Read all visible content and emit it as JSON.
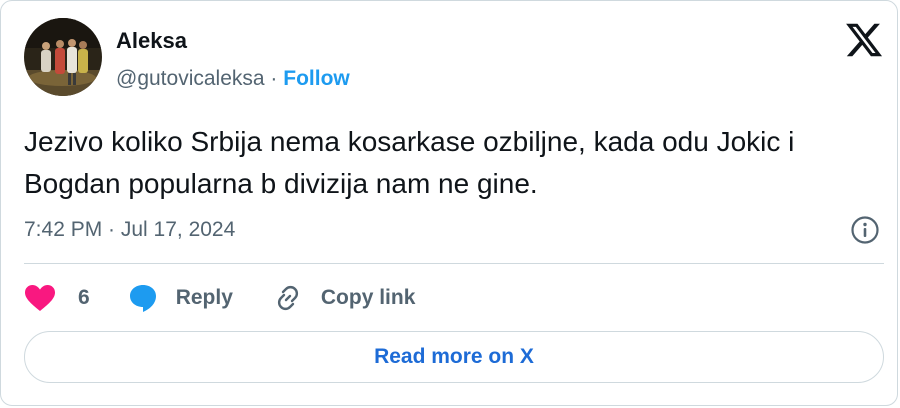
{
  "author": {
    "name": "Aleksa",
    "handle": "@gutovicaleksa",
    "separator": "·",
    "follow_label": "Follow"
  },
  "tweet": {
    "text": "Jezivo koliko Srbija nema kosarkase ozbiljne, kada odu Jokic i Bogdan popularna b divizija nam ne gine.",
    "timestamp": "7:42 PM · Jul 17, 2024"
  },
  "actions": {
    "like_count": "6",
    "reply_label": "Reply",
    "copy_link_label": "Copy link"
  },
  "read_more_label": "Read more on X",
  "icons": {
    "brand": "x-logo-icon",
    "info": "info-icon",
    "like": "heart-icon",
    "reply": "speech-bubble-icon",
    "copy_link": "link-icon"
  },
  "colors": {
    "like": "#f91880",
    "reply": "#1d9bf0",
    "follow": "#1d9bf0",
    "read_more": "#1d6bd6",
    "muted_text": "#536471",
    "border": "#cfd9de"
  }
}
